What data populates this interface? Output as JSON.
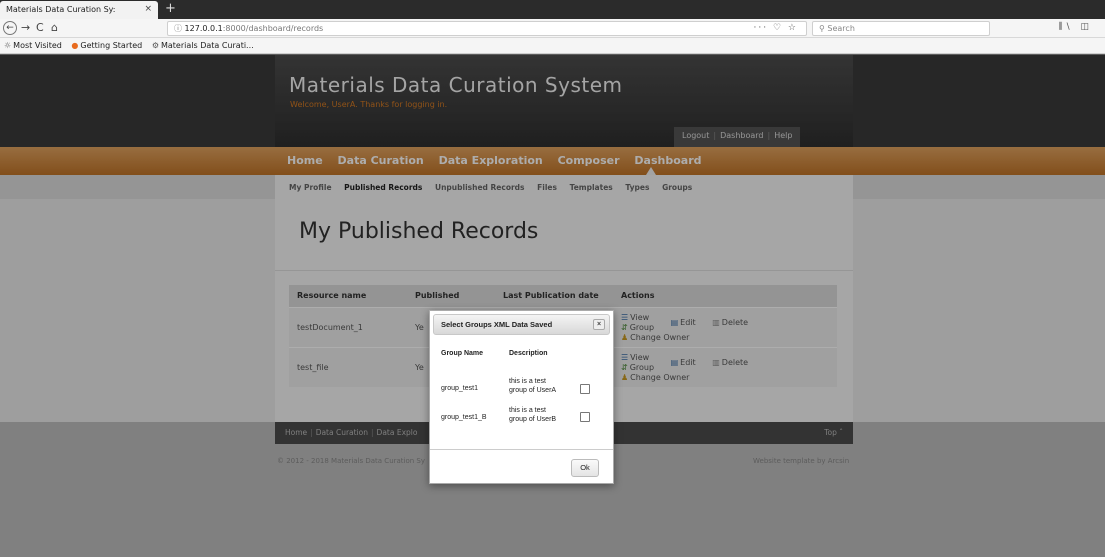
{
  "browser": {
    "tab_title": "Materials Data Curation Sy:",
    "tab_close": "×",
    "new_tab": "+",
    "back": "←",
    "forward": "→",
    "reload": "C",
    "home": "⌂",
    "url_host": "127.0.0.1",
    "url_rest": ":8000/dashboard/records",
    "url_actions": "··· ♡ ☆",
    "search_placeholder": "Search",
    "toolbar_right": "⫼\\ ◫",
    "bookmarks": [
      {
        "icon": "☼",
        "label": "Most Visited"
      },
      {
        "icon": "●",
        "label": "Getting Started"
      },
      {
        "icon": "⚙",
        "label": "Materials Data Curati..."
      }
    ]
  },
  "header": {
    "title": "Materials Data Curation System",
    "welcome": "Welcome, UserA. Thanks for logging in.",
    "links": [
      "Logout",
      "Dashboard",
      "Help"
    ]
  },
  "main_nav": [
    "Home",
    "Data Curation",
    "Data Exploration",
    "Composer",
    "Dashboard"
  ],
  "sub_nav": [
    "My Profile",
    "Published Records",
    "Unpublished Records",
    "Files",
    "Templates",
    "Types",
    "Groups"
  ],
  "page_title": "My Published Records",
  "table": {
    "headers": [
      "Resource name",
      "Published",
      "Last Publication date",
      "Actions"
    ],
    "rows": [
      {
        "name": "testDocument_1",
        "published": "Ye",
        "date": ""
      },
      {
        "name": "test_file",
        "published": "Ye",
        "date": ""
      }
    ],
    "actions": {
      "view": "View",
      "group": "Group",
      "edit": "Edit",
      "delete": "Delete",
      "change_owner": "Change Owner"
    }
  },
  "footer": {
    "links": [
      "Home",
      "Data Curation",
      "Data Explo"
    ],
    "top": "Top ˆ",
    "copyright": "© 2012 - 2018 Materials Data Curation Sy",
    "credit": "Website template by Arcsin"
  },
  "modal": {
    "title": "Select Groups XML Data Saved",
    "close": "×",
    "col_group": "Group Name",
    "col_description": "Description",
    "groups": [
      {
        "name": "group_test1",
        "desc_line1": "this is a test",
        "desc_line2": "group of UserA",
        "checked": false
      },
      {
        "name": "group_test1_B",
        "desc_line1": "this is a test",
        "desc_line2": "group of UserB",
        "checked": false
      }
    ],
    "ok": "Ok"
  }
}
